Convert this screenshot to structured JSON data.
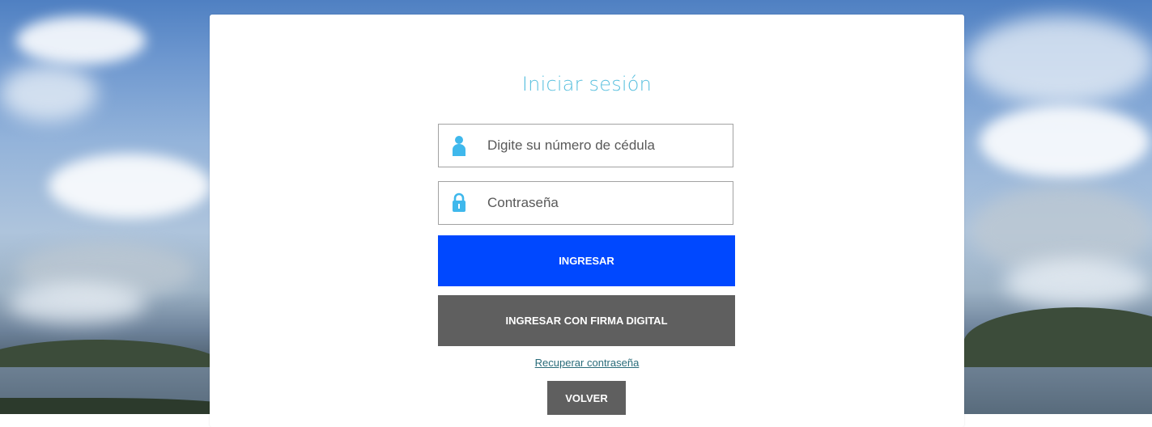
{
  "login": {
    "title": "Iniciar sesión",
    "id_field": {
      "placeholder": "Digite su número de cédula",
      "icon": "user-icon"
    },
    "password_field": {
      "placeholder": "Contraseña",
      "icon": "lock-icon"
    },
    "submit_label": "INGRESAR",
    "digital_signature_label": "INGRESAR CON FIRMA DIGITAL",
    "recover_label": "Recuperar contraseña",
    "back_label": "VOLVER"
  },
  "colors": {
    "title": "#5bc0de",
    "icon": "#3fb8ec",
    "primary_button": "#0048ff",
    "secondary_button": "#5f5f5f",
    "link": "#2a6c7a"
  }
}
